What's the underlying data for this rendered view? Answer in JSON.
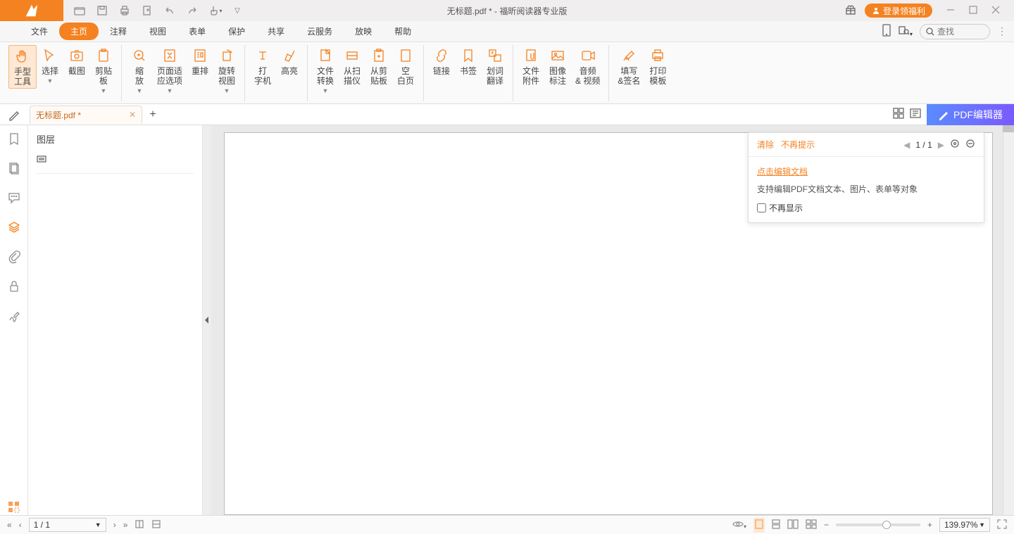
{
  "title": "无标题.pdf * - 福昕阅读器专业版",
  "login_label": "登录领福利",
  "search_placeholder": "查找",
  "menu": [
    "文件",
    "主页",
    "注释",
    "视图",
    "表单",
    "保护",
    "共享",
    "云服务",
    "放映",
    "帮助"
  ],
  "menu_active": 1,
  "ribbon": {
    "hand": "手型\n工具",
    "select": "选择",
    "snapshot": "截图",
    "clipboard": "剪贴\n板",
    "zoom": "缩\n放",
    "fit": "页面适\n应选项",
    "reflow": "重排",
    "rotate": "旋转\n视图",
    "typewriter": "打\n字机",
    "highlight": "高亮",
    "convert": "文件\n转换",
    "scan": "从扫\n描仪",
    "clip": "从剪\n贴板",
    "blank": "空\n白页",
    "link": "链接",
    "bookmark": "书签",
    "translate": "划词\n翻译",
    "attach": "文件\n附件",
    "image": "图像\n标注",
    "audio": "音频\n& 视频",
    "fill": "填写\n&签名",
    "print": "打印\n模板"
  },
  "doctab": "无标题.pdf *",
  "pdf_editor": "PDF编辑器",
  "panel_title": "图层",
  "tip": {
    "clear": "清除",
    "noremind": "不再提示",
    "page": "1 / 1",
    "link": "点击编辑文档",
    "desc": "支持编辑PDF文档文本、图片、表单等对象",
    "chk": "不再显示"
  },
  "status": {
    "page": "1 / 1",
    "zoom": "139.97%"
  }
}
